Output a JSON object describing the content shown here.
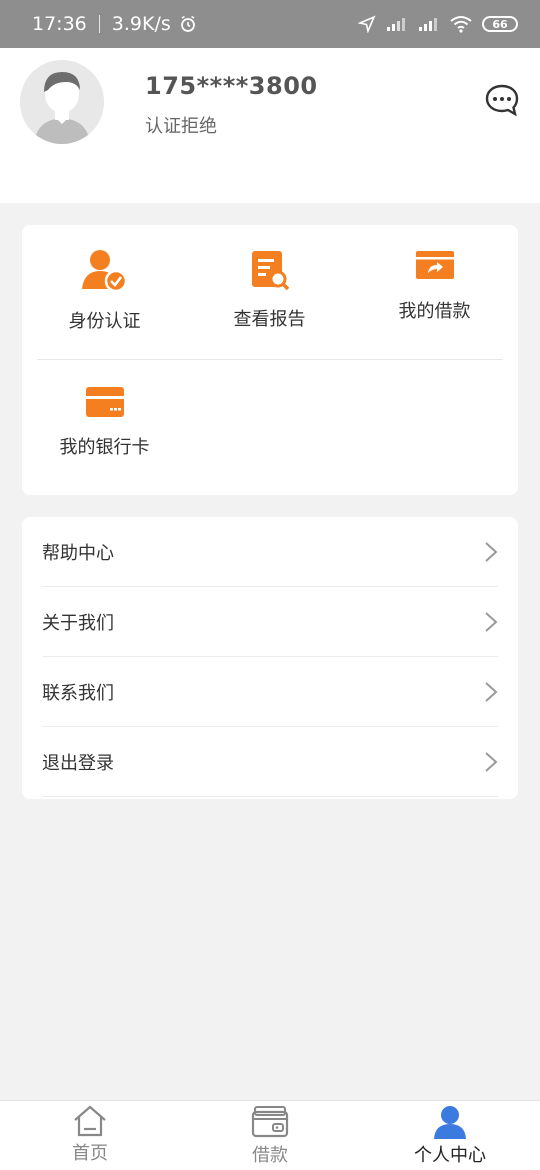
{
  "status_bar": {
    "time": "17:36",
    "speed": "3.9K/s",
    "battery": "66"
  },
  "profile": {
    "phone": "175****3800",
    "status": "认证拒绝"
  },
  "grid": {
    "items": [
      {
        "label": "身份认证",
        "icon": "user-check-icon"
      },
      {
        "label": "查看报告",
        "icon": "report-search-icon"
      },
      {
        "label": "我的借款",
        "icon": "loan-card-icon"
      },
      {
        "label": "我的银行卡",
        "icon": "bank-card-icon"
      }
    ]
  },
  "menu": {
    "items": [
      {
        "label": "帮助中心"
      },
      {
        "label": "关于我们"
      },
      {
        "label": "联系我们"
      },
      {
        "label": "退出登录"
      }
    ]
  },
  "tabbar": {
    "tabs": [
      {
        "label": "首页",
        "icon": "home-icon"
      },
      {
        "label": "借款",
        "icon": "wallet-icon"
      },
      {
        "label": "个人中心",
        "icon": "person-icon"
      }
    ],
    "active": "个人中心"
  },
  "colors": {
    "accent": "#f47f20",
    "tab_active": "#3b7be0"
  }
}
